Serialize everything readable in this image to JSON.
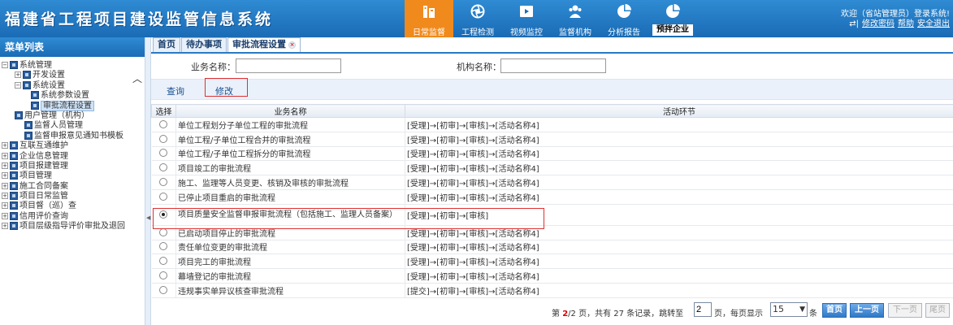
{
  "header": {
    "title": "福建省工程项目建设监管信息系统",
    "nav": [
      {
        "label": "日常监督",
        "icon": "building-icon",
        "active": true
      },
      {
        "label": "工程检测",
        "icon": "aperture-icon"
      },
      {
        "label": "视频监控",
        "icon": "video-icon"
      },
      {
        "label": "监督机构",
        "icon": "people-icon"
      },
      {
        "label": "分析报告",
        "icon": "pie-chart-icon"
      },
      {
        "label": "预拌企业",
        "icon": "pie-chart-icon"
      }
    ],
    "user": {
      "welcome": "欢迎（省站管理员）登录系统!",
      "change_password": "修改密码",
      "help": "帮助",
      "logout": "安全退出"
    }
  },
  "sidebar": {
    "title": "菜单列表",
    "items": [
      {
        "label": "系统管理"
      },
      {
        "label": "开发设置"
      },
      {
        "label": "系统设置"
      },
      {
        "label": "系统参数设置"
      },
      {
        "label": "审批流程设置"
      },
      {
        "label": "用户管理（机构）"
      },
      {
        "label": "监督人员管理"
      },
      {
        "label": "监督申报意见通知书模板"
      },
      {
        "label": "互联互通维护"
      },
      {
        "label": "企业信息管理"
      },
      {
        "label": "项目报建管理"
      },
      {
        "label": "项目管理"
      },
      {
        "label": "施工合同备案"
      },
      {
        "label": "项目日常监管"
      },
      {
        "label": "项目督（巡）查"
      },
      {
        "label": "信用评价查询"
      },
      {
        "label": "项目层级指导评价审批及退回"
      }
    ]
  },
  "tabs": [
    {
      "label": "首页"
    },
    {
      "label": "待办事项"
    },
    {
      "label": "审批流程设置"
    }
  ],
  "search": {
    "business_label": "业务名称：",
    "business_value": "",
    "org_label": "机构名称：",
    "org_value": ""
  },
  "actions": {
    "query": "查询",
    "modify": "修改"
  },
  "table": {
    "headers": {
      "select": "选择",
      "name": "业务名称",
      "steps": "活动环节"
    },
    "rows": [
      {
        "name": "单位工程划分子单位工程的审批流程",
        "steps": "[受理]→[初审]→[审核]→[活动名称4]"
      },
      {
        "name": "单位工程/子单位工程合并的审批流程",
        "steps": "[受理]→[初审]→[审核]→[活动名称4]"
      },
      {
        "name": "单位工程/子单位工程拆分的审批流程",
        "steps": "[受理]→[初审]→[审核]→[活动名称4]"
      },
      {
        "name": "项目竣工的审批流程",
        "steps": "[受理]→[初审]→[审核]→[活动名称4]"
      },
      {
        "name": "施工、监理等人员变更、核销及审核的审批流程",
        "steps": "[受理]→[初审]→[审核]→[活动名称4]"
      },
      {
        "name": "已停止项目重启的审批流程",
        "steps": "[受理]→[初审]→[审核]→[活动名称4]"
      },
      {
        "name": "项目质量安全监督申报审批流程（包括施工、监理人员备案）",
        "steps": "[受理]→[初审]→[审核]"
      },
      {
        "name": "已启动项目停止的审批流程",
        "steps": "[受理]→[初审]→[审核]→[活动名称4]"
      },
      {
        "name": "责任单位变更的审批流程",
        "steps": "[受理]→[初审]→[审核]→[活动名称4]"
      },
      {
        "name": "项目完工的审批流程",
        "steps": "[受理]→[初审]→[审核]→[活动名称4]"
      },
      {
        "name": "幕墙登记的审批流程",
        "steps": "[受理]→[初审]→[审核]→[活动名称4]"
      },
      {
        "name": "违规事实单异议核查审批流程",
        "steps": "[提交]→[初审]→[审核]→[活动名称4]"
      }
    ]
  },
  "pager": {
    "prefix": "第",
    "current": "2",
    "mid1": "/2 页，共有",
    "total": "27",
    "mid2": "条记录，跳转至",
    "jump_value": "2",
    "mid3": "页，每页显示",
    "page_size": "15",
    "suffix": "条",
    "first": "首页",
    "prev": "上一页",
    "next": "下一页",
    "last": "尾页"
  }
}
